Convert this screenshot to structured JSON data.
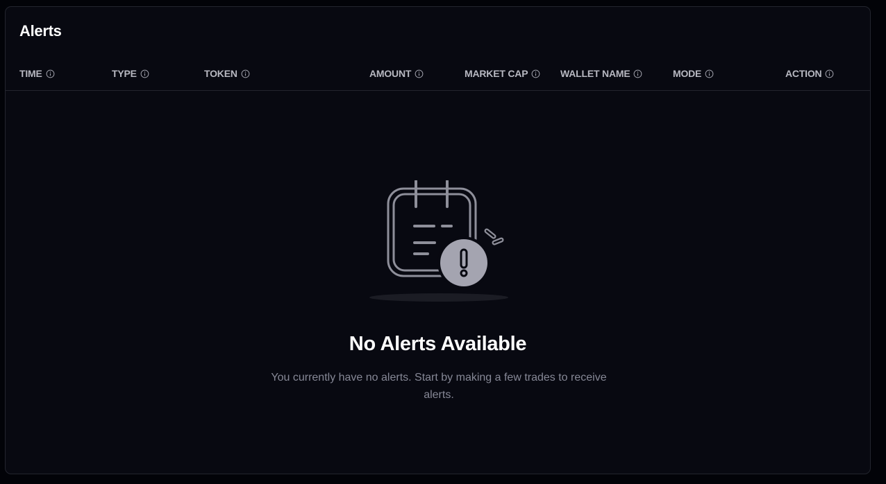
{
  "alerts": {
    "title": "Alerts",
    "columns": [
      {
        "label": "TIME",
        "icon": "info-icon"
      },
      {
        "label": "TYPE",
        "icon": "info-icon"
      },
      {
        "label": "TOKEN",
        "icon": "info-icon"
      },
      {
        "label": "AMOUNT",
        "icon": "info-icon"
      },
      {
        "label": "MARKET CAP",
        "icon": "info-icon"
      },
      {
        "label": "WALLET NAME",
        "icon": "info-icon"
      },
      {
        "label": "MODE",
        "icon": "info-icon"
      },
      {
        "label": "ACTION",
        "icon": "info-icon"
      }
    ],
    "empty_state": {
      "icon": "calendar-alert-icon",
      "title": "No Alerts Available",
      "description": "You currently have no alerts. Start by making a few trades to receive alerts."
    }
  },
  "colors": {
    "background": "#020308",
    "panel": "#080911",
    "border": "#23252e",
    "header_text": "#b7b8c1",
    "muted_text": "#868896",
    "illustration": "#a0a0ad"
  }
}
